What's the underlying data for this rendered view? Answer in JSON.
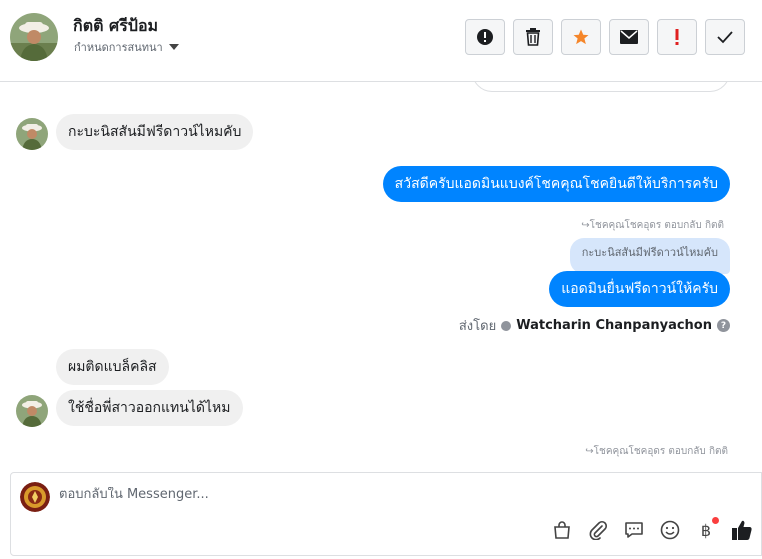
{
  "header": {
    "contact_name": "กิตติ ศรีป้อม",
    "assign_label": "กำหนดการสนทนา",
    "actions": [
      {
        "name": "spam",
        "icon": "alert-circle-icon"
      },
      {
        "name": "delete",
        "icon": "trash-icon"
      },
      {
        "name": "star",
        "icon": "star-icon",
        "color": "#f5862a"
      },
      {
        "name": "mark-unread",
        "icon": "envelope-icon"
      },
      {
        "name": "follow-up",
        "icon": "exclamation-icon",
        "color": "#e02020"
      },
      {
        "name": "done",
        "icon": "checkmark-icon"
      }
    ]
  },
  "messages": {
    "m1": "กะบะนิสสันมีฟรีดาวน์ไหมคับ",
    "m2": "สวัสดีครับแอดมินแบงค์โชคคุณโชคยินดีให้บริการครับ",
    "m2_meta": "↪โชคคุณโชคอุดร ตอบกลับ กิตติ",
    "m3_quote": "กะบะนิสสันมีฟรีดาวน์ไหมคับ",
    "m3": "แอดมินยื่นฟรีดาวน์ให้ครับ",
    "sent_by_label": "ส่งโดย",
    "sent_by_agent": "Watcharin Chanpanyachon",
    "help_glyph": "?",
    "m4": "ผมติดแบล็คลิส",
    "m5": "ใช้ชื่อพี่สาวออกแทนได้ไหม",
    "m5_meta": "↪โชคคุณโชคอุดร ตอบกลับ กิตติ"
  },
  "composer": {
    "placeholder": "ตอบกลับใน Messenger...",
    "tools": [
      "shopping-bag-icon",
      "paperclip-icon",
      "saved-replies-icon",
      "emoji-icon",
      "baht-payment-icon",
      "like-icon"
    ],
    "baht_glyph": "฿"
  },
  "colors": {
    "outgoing_bubble": "#0084ff",
    "incoming_bubble": "#f0f0f0",
    "quote_bubble": "#d6e6fb",
    "notification_dot": "#fa3e3e"
  }
}
